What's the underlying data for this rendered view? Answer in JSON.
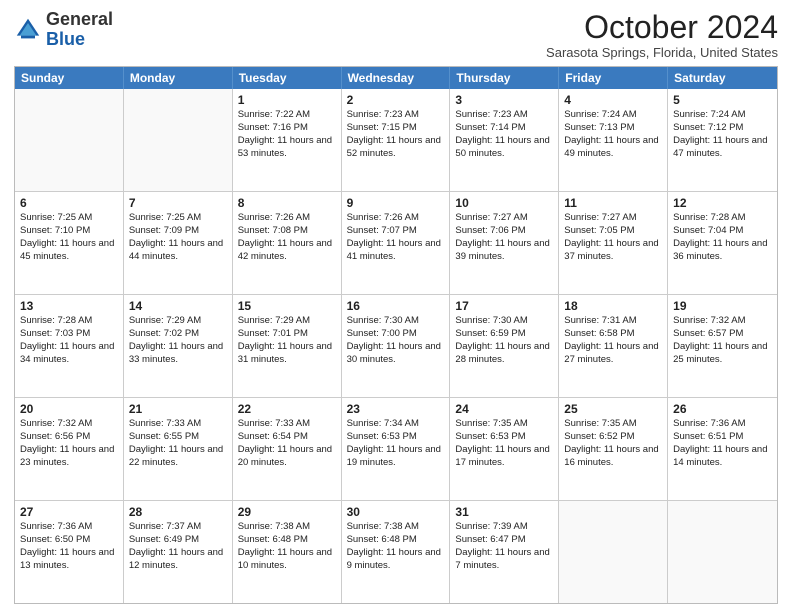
{
  "header": {
    "logo_general": "General",
    "logo_blue": "Blue",
    "month_title": "October 2024",
    "subtitle": "Sarasota Springs, Florida, United States"
  },
  "days_of_week": [
    "Sunday",
    "Monday",
    "Tuesday",
    "Wednesday",
    "Thursday",
    "Friday",
    "Saturday"
  ],
  "weeks": [
    [
      {
        "day": "",
        "sunrise": "",
        "sunset": "",
        "daylight": ""
      },
      {
        "day": "",
        "sunrise": "",
        "sunset": "",
        "daylight": ""
      },
      {
        "day": "1",
        "sunrise": "Sunrise: 7:22 AM",
        "sunset": "Sunset: 7:16 PM",
        "daylight": "Daylight: 11 hours and 53 minutes."
      },
      {
        "day": "2",
        "sunrise": "Sunrise: 7:23 AM",
        "sunset": "Sunset: 7:15 PM",
        "daylight": "Daylight: 11 hours and 52 minutes."
      },
      {
        "day": "3",
        "sunrise": "Sunrise: 7:23 AM",
        "sunset": "Sunset: 7:14 PM",
        "daylight": "Daylight: 11 hours and 50 minutes."
      },
      {
        "day": "4",
        "sunrise": "Sunrise: 7:24 AM",
        "sunset": "Sunset: 7:13 PM",
        "daylight": "Daylight: 11 hours and 49 minutes."
      },
      {
        "day": "5",
        "sunrise": "Sunrise: 7:24 AM",
        "sunset": "Sunset: 7:12 PM",
        "daylight": "Daylight: 11 hours and 47 minutes."
      }
    ],
    [
      {
        "day": "6",
        "sunrise": "Sunrise: 7:25 AM",
        "sunset": "Sunset: 7:10 PM",
        "daylight": "Daylight: 11 hours and 45 minutes."
      },
      {
        "day": "7",
        "sunrise": "Sunrise: 7:25 AM",
        "sunset": "Sunset: 7:09 PM",
        "daylight": "Daylight: 11 hours and 44 minutes."
      },
      {
        "day": "8",
        "sunrise": "Sunrise: 7:26 AM",
        "sunset": "Sunset: 7:08 PM",
        "daylight": "Daylight: 11 hours and 42 minutes."
      },
      {
        "day": "9",
        "sunrise": "Sunrise: 7:26 AM",
        "sunset": "Sunset: 7:07 PM",
        "daylight": "Daylight: 11 hours and 41 minutes."
      },
      {
        "day": "10",
        "sunrise": "Sunrise: 7:27 AM",
        "sunset": "Sunset: 7:06 PM",
        "daylight": "Daylight: 11 hours and 39 minutes."
      },
      {
        "day": "11",
        "sunrise": "Sunrise: 7:27 AM",
        "sunset": "Sunset: 7:05 PM",
        "daylight": "Daylight: 11 hours and 37 minutes."
      },
      {
        "day": "12",
        "sunrise": "Sunrise: 7:28 AM",
        "sunset": "Sunset: 7:04 PM",
        "daylight": "Daylight: 11 hours and 36 minutes."
      }
    ],
    [
      {
        "day": "13",
        "sunrise": "Sunrise: 7:28 AM",
        "sunset": "Sunset: 7:03 PM",
        "daylight": "Daylight: 11 hours and 34 minutes."
      },
      {
        "day": "14",
        "sunrise": "Sunrise: 7:29 AM",
        "sunset": "Sunset: 7:02 PM",
        "daylight": "Daylight: 11 hours and 33 minutes."
      },
      {
        "day": "15",
        "sunrise": "Sunrise: 7:29 AM",
        "sunset": "Sunset: 7:01 PM",
        "daylight": "Daylight: 11 hours and 31 minutes."
      },
      {
        "day": "16",
        "sunrise": "Sunrise: 7:30 AM",
        "sunset": "Sunset: 7:00 PM",
        "daylight": "Daylight: 11 hours and 30 minutes."
      },
      {
        "day": "17",
        "sunrise": "Sunrise: 7:30 AM",
        "sunset": "Sunset: 6:59 PM",
        "daylight": "Daylight: 11 hours and 28 minutes."
      },
      {
        "day": "18",
        "sunrise": "Sunrise: 7:31 AM",
        "sunset": "Sunset: 6:58 PM",
        "daylight": "Daylight: 11 hours and 27 minutes."
      },
      {
        "day": "19",
        "sunrise": "Sunrise: 7:32 AM",
        "sunset": "Sunset: 6:57 PM",
        "daylight": "Daylight: 11 hours and 25 minutes."
      }
    ],
    [
      {
        "day": "20",
        "sunrise": "Sunrise: 7:32 AM",
        "sunset": "Sunset: 6:56 PM",
        "daylight": "Daylight: 11 hours and 23 minutes."
      },
      {
        "day": "21",
        "sunrise": "Sunrise: 7:33 AM",
        "sunset": "Sunset: 6:55 PM",
        "daylight": "Daylight: 11 hours and 22 minutes."
      },
      {
        "day": "22",
        "sunrise": "Sunrise: 7:33 AM",
        "sunset": "Sunset: 6:54 PM",
        "daylight": "Daylight: 11 hours and 20 minutes."
      },
      {
        "day": "23",
        "sunrise": "Sunrise: 7:34 AM",
        "sunset": "Sunset: 6:53 PM",
        "daylight": "Daylight: 11 hours and 19 minutes."
      },
      {
        "day": "24",
        "sunrise": "Sunrise: 7:35 AM",
        "sunset": "Sunset: 6:53 PM",
        "daylight": "Daylight: 11 hours and 17 minutes."
      },
      {
        "day": "25",
        "sunrise": "Sunrise: 7:35 AM",
        "sunset": "Sunset: 6:52 PM",
        "daylight": "Daylight: 11 hours and 16 minutes."
      },
      {
        "day": "26",
        "sunrise": "Sunrise: 7:36 AM",
        "sunset": "Sunset: 6:51 PM",
        "daylight": "Daylight: 11 hours and 14 minutes."
      }
    ],
    [
      {
        "day": "27",
        "sunrise": "Sunrise: 7:36 AM",
        "sunset": "Sunset: 6:50 PM",
        "daylight": "Daylight: 11 hours and 13 minutes."
      },
      {
        "day": "28",
        "sunrise": "Sunrise: 7:37 AM",
        "sunset": "Sunset: 6:49 PM",
        "daylight": "Daylight: 11 hours and 12 minutes."
      },
      {
        "day": "29",
        "sunrise": "Sunrise: 7:38 AM",
        "sunset": "Sunset: 6:48 PM",
        "daylight": "Daylight: 11 hours and 10 minutes."
      },
      {
        "day": "30",
        "sunrise": "Sunrise: 7:38 AM",
        "sunset": "Sunset: 6:48 PM",
        "daylight": "Daylight: 11 hours and 9 minutes."
      },
      {
        "day": "31",
        "sunrise": "Sunrise: 7:39 AM",
        "sunset": "Sunset: 6:47 PM",
        "daylight": "Daylight: 11 hours and 7 minutes."
      },
      {
        "day": "",
        "sunrise": "",
        "sunset": "",
        "daylight": ""
      },
      {
        "day": "",
        "sunrise": "",
        "sunset": "",
        "daylight": ""
      }
    ]
  ]
}
